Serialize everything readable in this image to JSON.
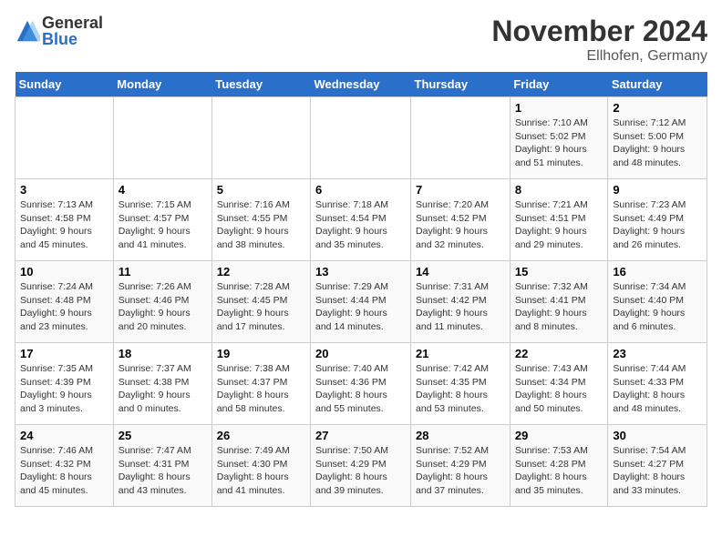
{
  "logo": {
    "general": "General",
    "blue": "Blue"
  },
  "header": {
    "month": "November 2024",
    "location": "Ellhofen, Germany"
  },
  "weekdays": [
    "Sunday",
    "Monday",
    "Tuesday",
    "Wednesday",
    "Thursday",
    "Friday",
    "Saturday"
  ],
  "weeks": [
    [
      {
        "day": null
      },
      {
        "day": null
      },
      {
        "day": null
      },
      {
        "day": null
      },
      {
        "day": null
      },
      {
        "day": "1",
        "sunrise": "7:10 AM",
        "sunset": "5:02 PM",
        "daylight": "9 hours and 51 minutes."
      },
      {
        "day": "2",
        "sunrise": "7:12 AM",
        "sunset": "5:00 PM",
        "daylight": "9 hours and 48 minutes."
      }
    ],
    [
      {
        "day": "3",
        "sunrise": "7:13 AM",
        "sunset": "4:58 PM",
        "daylight": "9 hours and 45 minutes."
      },
      {
        "day": "4",
        "sunrise": "7:15 AM",
        "sunset": "4:57 PM",
        "daylight": "9 hours and 41 minutes."
      },
      {
        "day": "5",
        "sunrise": "7:16 AM",
        "sunset": "4:55 PM",
        "daylight": "9 hours and 38 minutes."
      },
      {
        "day": "6",
        "sunrise": "7:18 AM",
        "sunset": "4:54 PM",
        "daylight": "9 hours and 35 minutes."
      },
      {
        "day": "7",
        "sunrise": "7:20 AM",
        "sunset": "4:52 PM",
        "daylight": "9 hours and 32 minutes."
      },
      {
        "day": "8",
        "sunrise": "7:21 AM",
        "sunset": "4:51 PM",
        "daylight": "9 hours and 29 minutes."
      },
      {
        "day": "9",
        "sunrise": "7:23 AM",
        "sunset": "4:49 PM",
        "daylight": "9 hours and 26 minutes."
      }
    ],
    [
      {
        "day": "10",
        "sunrise": "7:24 AM",
        "sunset": "4:48 PM",
        "daylight": "9 hours and 23 minutes."
      },
      {
        "day": "11",
        "sunrise": "7:26 AM",
        "sunset": "4:46 PM",
        "daylight": "9 hours and 20 minutes."
      },
      {
        "day": "12",
        "sunrise": "7:28 AM",
        "sunset": "4:45 PM",
        "daylight": "9 hours and 17 minutes."
      },
      {
        "day": "13",
        "sunrise": "7:29 AM",
        "sunset": "4:44 PM",
        "daylight": "9 hours and 14 minutes."
      },
      {
        "day": "14",
        "sunrise": "7:31 AM",
        "sunset": "4:42 PM",
        "daylight": "9 hours and 11 minutes."
      },
      {
        "day": "15",
        "sunrise": "7:32 AM",
        "sunset": "4:41 PM",
        "daylight": "9 hours and 8 minutes."
      },
      {
        "day": "16",
        "sunrise": "7:34 AM",
        "sunset": "4:40 PM",
        "daylight": "9 hours and 6 minutes."
      }
    ],
    [
      {
        "day": "17",
        "sunrise": "7:35 AM",
        "sunset": "4:39 PM",
        "daylight": "9 hours and 3 minutes."
      },
      {
        "day": "18",
        "sunrise": "7:37 AM",
        "sunset": "4:38 PM",
        "daylight": "9 hours and 0 minutes."
      },
      {
        "day": "19",
        "sunrise": "7:38 AM",
        "sunset": "4:37 PM",
        "daylight": "8 hours and 58 minutes."
      },
      {
        "day": "20",
        "sunrise": "7:40 AM",
        "sunset": "4:36 PM",
        "daylight": "8 hours and 55 minutes."
      },
      {
        "day": "21",
        "sunrise": "7:42 AM",
        "sunset": "4:35 PM",
        "daylight": "8 hours and 53 minutes."
      },
      {
        "day": "22",
        "sunrise": "7:43 AM",
        "sunset": "4:34 PM",
        "daylight": "8 hours and 50 minutes."
      },
      {
        "day": "23",
        "sunrise": "7:44 AM",
        "sunset": "4:33 PM",
        "daylight": "8 hours and 48 minutes."
      }
    ],
    [
      {
        "day": "24",
        "sunrise": "7:46 AM",
        "sunset": "4:32 PM",
        "daylight": "8 hours and 45 minutes."
      },
      {
        "day": "25",
        "sunrise": "7:47 AM",
        "sunset": "4:31 PM",
        "daylight": "8 hours and 43 minutes."
      },
      {
        "day": "26",
        "sunrise": "7:49 AM",
        "sunset": "4:30 PM",
        "daylight": "8 hours and 41 minutes."
      },
      {
        "day": "27",
        "sunrise": "7:50 AM",
        "sunset": "4:29 PM",
        "daylight": "8 hours and 39 minutes."
      },
      {
        "day": "28",
        "sunrise": "7:52 AM",
        "sunset": "4:29 PM",
        "daylight": "8 hours and 37 minutes."
      },
      {
        "day": "29",
        "sunrise": "7:53 AM",
        "sunset": "4:28 PM",
        "daylight": "8 hours and 35 minutes."
      },
      {
        "day": "30",
        "sunrise": "7:54 AM",
        "sunset": "4:27 PM",
        "daylight": "8 hours and 33 minutes."
      }
    ]
  ]
}
